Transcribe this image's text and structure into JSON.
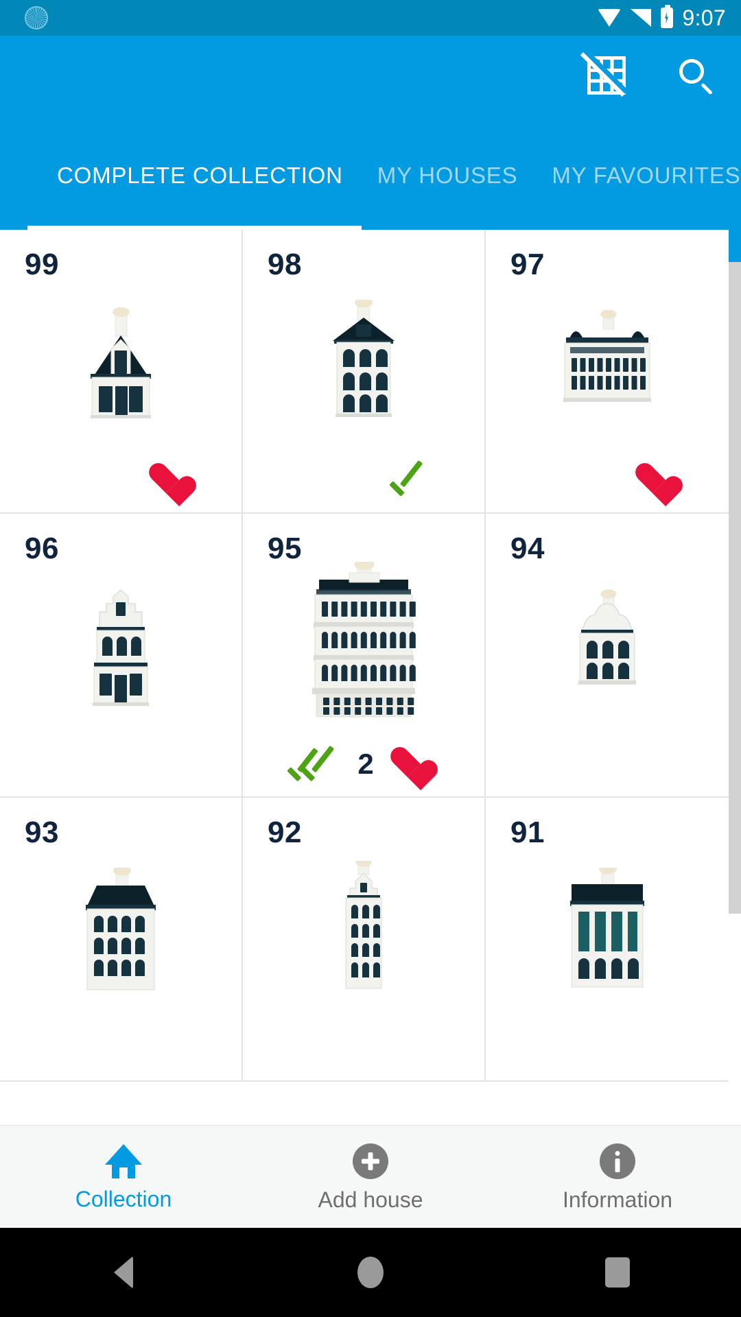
{
  "status_bar": {
    "time": "9:07",
    "icons": [
      "sync-icon",
      "wifi-icon",
      "signal-icon",
      "battery-charging-icon"
    ],
    "background_color": "#0288b8"
  },
  "app_bar": {
    "background_color": "#029ae0",
    "actions": [
      {
        "name": "grid-off-icon",
        "label": "Grid off"
      },
      {
        "name": "search-icon",
        "label": "Search"
      }
    ]
  },
  "tabs": {
    "active_index": 0,
    "items": [
      {
        "label": "COMPLETE COLLECTION"
      },
      {
        "label": "MY HOUSES"
      },
      {
        "label": "MY FAVOURITES"
      }
    ]
  },
  "colors": {
    "accent": "#029ae0",
    "status_bar": "#0288b8",
    "heart_red": "#e8123c",
    "check_green": "#4ca313",
    "number_navy": "#10253d",
    "nav_inactive": "#6f6f6f"
  },
  "grid": {
    "cells": [
      {
        "number": "99",
        "house_style": "gabled-villa",
        "owned": false,
        "count": "",
        "favourite": true,
        "checked": false
      },
      {
        "number": "98",
        "house_style": "tall-townhouse",
        "owned": true,
        "count": "",
        "favourite": false,
        "checked": true
      },
      {
        "number": "97",
        "house_style": "wide-castle",
        "owned": false,
        "count": "",
        "favourite": true,
        "checked": false
      },
      {
        "number": "96",
        "house_style": "step-gable",
        "owned": false,
        "count": "",
        "favourite": false,
        "checked": false
      },
      {
        "number": "95",
        "house_style": "grand-hotel",
        "owned": true,
        "count": "2",
        "favourite": true,
        "checked": true
      },
      {
        "number": "94",
        "house_style": "bell-gable",
        "owned": false,
        "count": "",
        "favourite": false,
        "checked": false
      },
      {
        "number": "93",
        "house_style": "mansard-house",
        "owned": false,
        "count": "",
        "favourite": false,
        "checked": false
      },
      {
        "number": "92",
        "house_style": "narrow-spire",
        "owned": false,
        "count": "",
        "favourite": false,
        "checked": false
      },
      {
        "number": "91",
        "house_style": "flat-roof-manor",
        "owned": false,
        "count": "",
        "favourite": false,
        "checked": false
      }
    ]
  },
  "scrollbar": {
    "visible": true
  },
  "bottom_nav": {
    "active_index": 0,
    "items": [
      {
        "label": "Collection",
        "icon": "home-icon"
      },
      {
        "label": "Add house",
        "icon": "plus-circle-icon"
      },
      {
        "label": "Information",
        "icon": "info-circle-icon"
      }
    ]
  },
  "android_nav": {
    "items": [
      {
        "name": "back-button"
      },
      {
        "name": "home-button"
      },
      {
        "name": "recents-button"
      }
    ]
  }
}
